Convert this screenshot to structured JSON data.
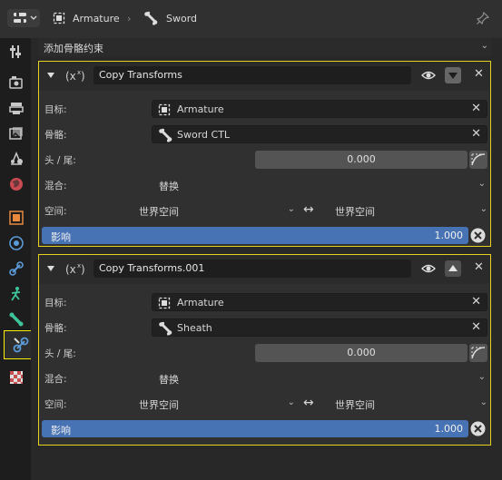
{
  "header": {
    "breadcrumb": [
      "Armature",
      "Sword"
    ]
  },
  "add_constraint": "添加骨骼约束",
  "constraints": [
    {
      "name": "Copy Transforms",
      "target_label": "目标:",
      "target": "Armature",
      "bone_label": "骨骼:",
      "bone": "Sword CTL",
      "head_tail_label": "头 / 尾:",
      "head_tail": "0.000",
      "mix_label": "混合:",
      "mix": "替换",
      "space_label": "空间:",
      "owner_space": "世界空间",
      "arrow": "↔",
      "target_space": "世界空间",
      "influence_label": "影响",
      "influence": "1.000",
      "move_arrow": "down"
    },
    {
      "name": "Copy Transforms.001",
      "target_label": "目标:",
      "target": "Armature",
      "bone_label": "骨骼:",
      "bone": "Sheath",
      "head_tail_label": "头 / 尾:",
      "head_tail": "0.000",
      "mix_label": "混合:",
      "mix": "替换",
      "space_label": "空间:",
      "owner_space": "世界空间",
      "arrow": "↔",
      "target_space": "世界空间",
      "influence_label": "影响",
      "influence": "1.000",
      "move_arrow": "up"
    }
  ],
  "colors": {
    "active_outline": "#e5d11f",
    "influence_bar": "#4772b3"
  }
}
